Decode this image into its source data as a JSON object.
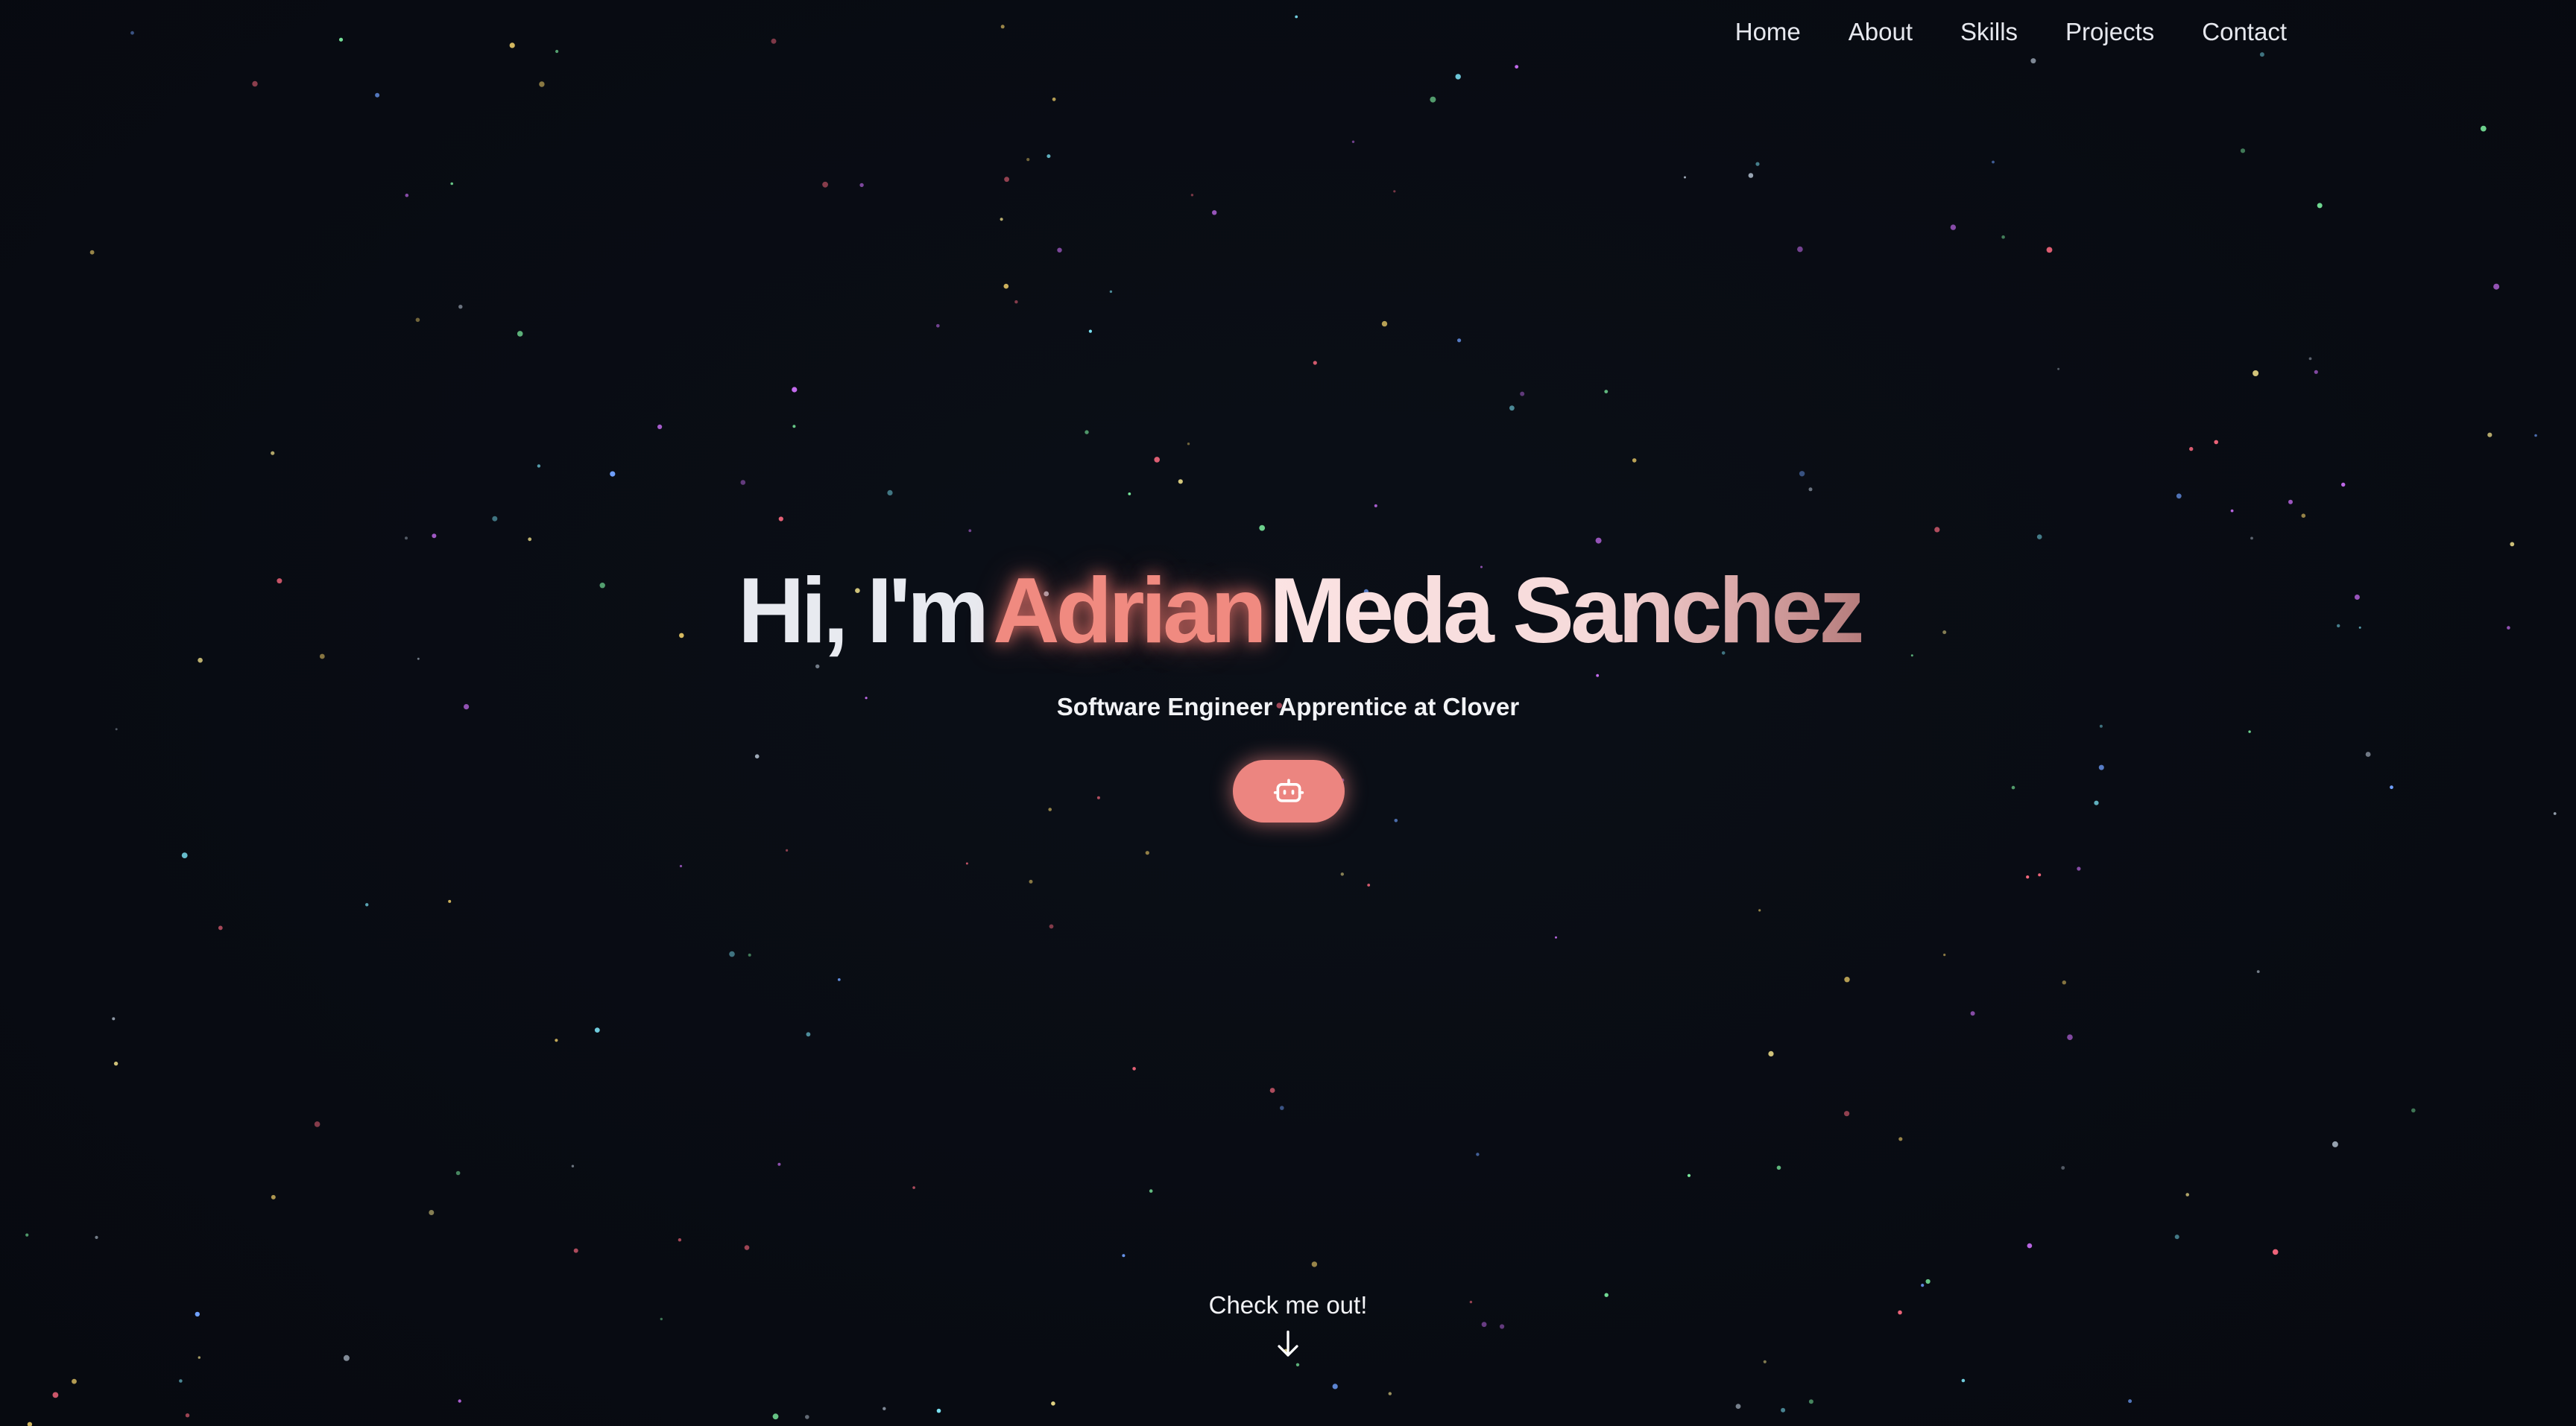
{
  "nav": {
    "items": [
      {
        "label": "Home"
      },
      {
        "label": "About"
      },
      {
        "label": "Skills"
      },
      {
        "label": "Projects"
      },
      {
        "label": "Contact"
      }
    ]
  },
  "hero": {
    "greeting": "Hi, I'm",
    "first_name": "Adrian",
    "rest_name": "Meda Sanchez",
    "subtitle": "Software Engineer Apprentice at Clover",
    "button_icon": "robot-icon"
  },
  "scroll_hint": {
    "label": "Check me out!",
    "icon": "arrow-down-icon"
  },
  "colors": {
    "background": "#090c13",
    "accent": "#ec8580",
    "text": "#e8eaf0"
  }
}
